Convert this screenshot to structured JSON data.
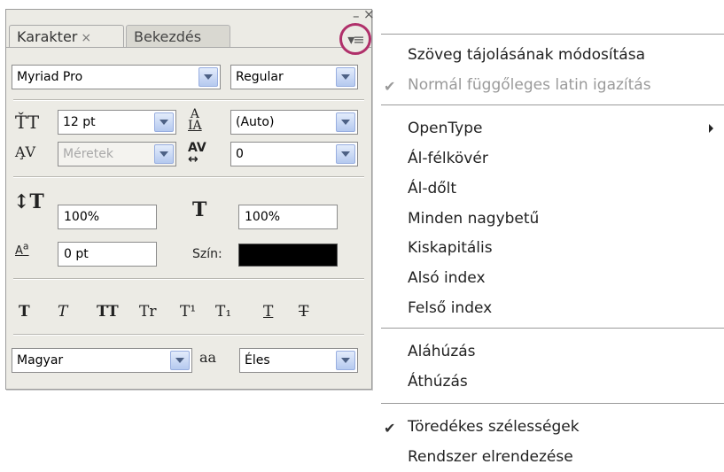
{
  "panel": {
    "tabs": [
      {
        "label": "Karakter",
        "close": "×"
      },
      {
        "label": "Bekezdés"
      }
    ],
    "window_controls": {
      "minimize": "–",
      "close": "×"
    },
    "font_family": "Myriad Pro",
    "font_style": "Regular",
    "font_size": "12 pt",
    "leading": "(Auto)",
    "kerning": "Méretek",
    "tracking": "0",
    "vertical_scale": "100%",
    "horizontal_scale": "100%",
    "baseline_shift": "0 pt",
    "color_label": "Szín:",
    "color": "#000000",
    "style_buttons": [
      "T",
      "T",
      "TT",
      "Tr",
      "T¹",
      "T₁",
      "T",
      "T"
    ],
    "language": "Magyar",
    "aa_icon": "aa",
    "antialias": "Éles"
  },
  "menu": {
    "items": [
      {
        "label": "Szöveg tájolásának módosítása",
        "checked": false,
        "disabled": false
      },
      {
        "label": "Normál függőleges latin igazítás",
        "checked": true,
        "disabled": true
      },
      {
        "label": "OpenType",
        "submenu": true
      },
      {
        "label": "Ál-félkövér"
      },
      {
        "label": "Ál-dőlt"
      },
      {
        "label": "Minden nagybetű"
      },
      {
        "label": "Kiskapitális"
      },
      {
        "label": "Alsó index"
      },
      {
        "label": "Felső index"
      },
      {
        "label": "Aláhúzás"
      },
      {
        "label": "Áthúzás"
      },
      {
        "label": "Töredékes szélességek",
        "checked": true
      },
      {
        "label": "Rendszer elrendezése"
      }
    ],
    "check_glyph": "✔"
  },
  "colors": {
    "panel_bg": "#ECEBE5",
    "highlight_circle": "#B0306A",
    "combo_arrow": "#B5C9EF"
  }
}
